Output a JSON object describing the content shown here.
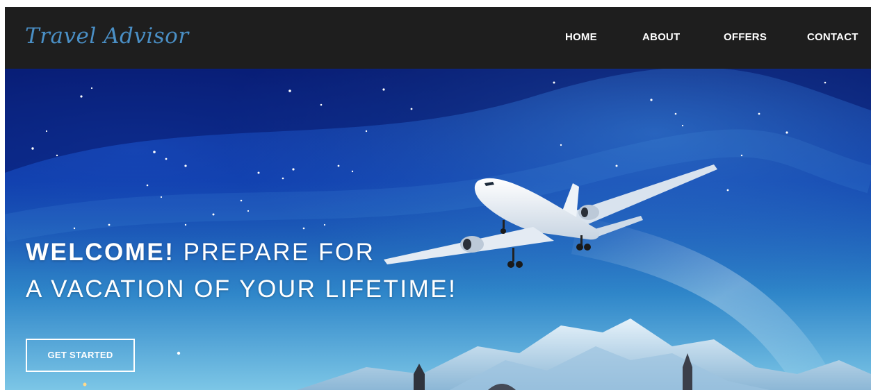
{
  "brand": {
    "name": "Travel Advisor"
  },
  "nav": {
    "home": "HOME",
    "about": "ABOUT",
    "offers": "OFFERS",
    "contact": "CONTACT"
  },
  "hero": {
    "title_strong": "WELCOME!",
    "title_rest": " PREPARE FOR",
    "title_line2": "A VACATION OF YOUR LIFETIME!",
    "cta_label": "GET STARTED",
    "image": "airplane-night-sky-mountains"
  },
  "colors": {
    "navbar_bg": "#1e1e1e",
    "brand": "#4a8fc5",
    "text": "#ffffff",
    "sky_dark": "#071a6b",
    "sky_light": "#5fb6e0"
  }
}
